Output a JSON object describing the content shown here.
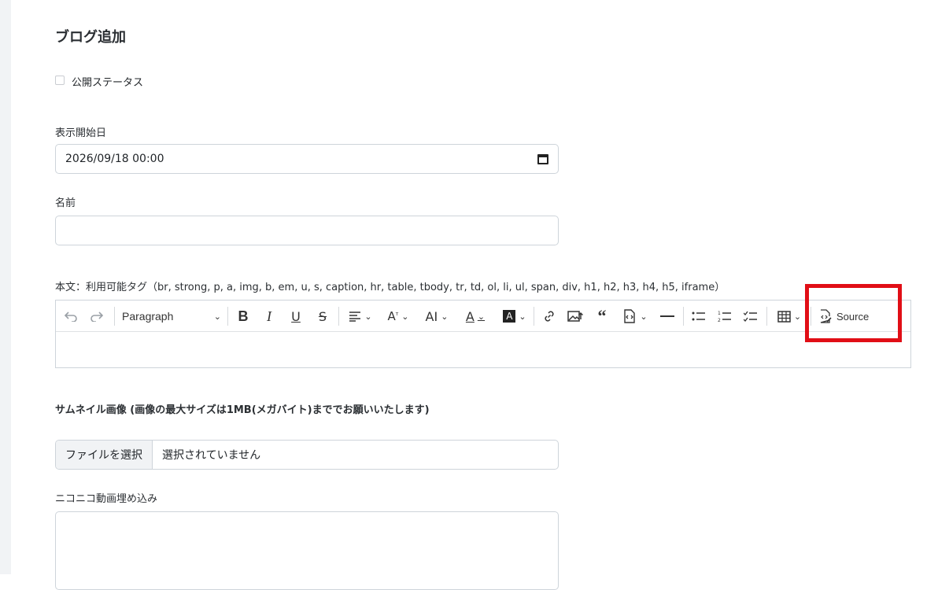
{
  "page": {
    "title": "ブログ追加"
  },
  "form": {
    "public_status_label": "公開ステータス",
    "start_date_label": "表示開始日",
    "start_date_value": "2026/09/18 00:00",
    "name_label": "名前",
    "name_value": "",
    "body_label": "本文：利用可能タグ（br, strong, p, a, img, b, em, u, s, caption, hr, table, tbody, tr, td, ol, li, ul, span, div, h1, h2, h3, h4, h5, iframe）",
    "thumbnail_label": "サムネイル画像 (画像の最大サイズは1MB(メガバイト)まででお願いいたします)",
    "file_button_label": "ファイルを選択",
    "file_status": "選択されていません",
    "niconico_label": "ニコニコ動画埋め込み"
  },
  "editor": {
    "toolbar": {
      "paragraph_label": "Paragraph",
      "source_label": "Source"
    }
  },
  "icons": {
    "undo": "undo-icon",
    "redo": "redo-icon",
    "bold": "bold-icon",
    "italic": "italic-icon",
    "underline": "underline-icon",
    "strike": "strikethrough-icon",
    "align": "align-icon",
    "font_size": "font-size-icon",
    "font_family": "font-family-icon",
    "font_color": "font-color-icon",
    "bg_color": "background-color-icon",
    "link": "link-icon",
    "image": "image-upload-icon",
    "quote": "blockquote-icon",
    "html_embed": "html-embed-icon",
    "hr": "horizontal-line-icon",
    "bullet": "bulleted-list-icon",
    "numbered": "numbered-list-icon",
    "todo": "todo-list-icon",
    "table": "table-icon",
    "source": "source-icon"
  },
  "colors": {
    "highlight": "#e10e16",
    "border": "#ced4da"
  }
}
